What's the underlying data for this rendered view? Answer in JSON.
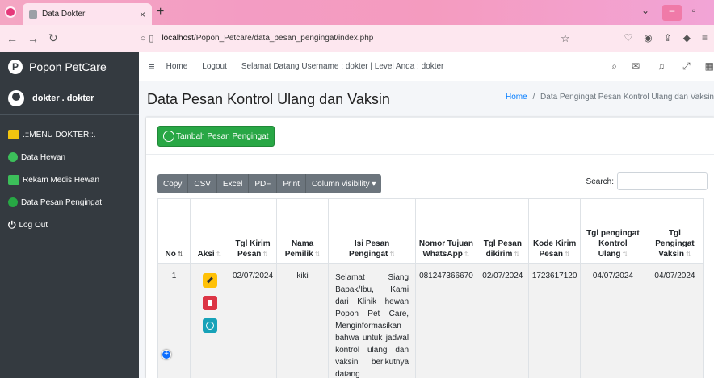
{
  "browser": {
    "tab_title": "Data Dokter",
    "tab_close": "×",
    "new_tab": "+",
    "url_host": "localhost",
    "url_path": "/Popon_Petcare/data_pesan_pengingat/index.php"
  },
  "sidebar": {
    "brand": "Popon PetCare",
    "brand_logo": "P",
    "user": "dokter . dokter",
    "items": [
      {
        "label": ".::MENU DOKTER::.",
        "icon": "id-card-icon"
      },
      {
        "label": "Data Hewan",
        "icon": "users-icon"
      },
      {
        "label": "Rekam Medis Hewan",
        "icon": "tags-icon"
      },
      {
        "label": "Data Pesan Pengingat",
        "icon": "whatsapp-icon"
      },
      {
        "label": "Log Out",
        "icon": "power-icon"
      }
    ]
  },
  "navbar": {
    "home": "Home",
    "logout": "Logout",
    "welcome": "Selamat Datang Username : dokter | Level Anda : dokter"
  },
  "content": {
    "title": "Data Pesan Kontrol Ulang dan Vaksin",
    "breadcrumb_home": "Home",
    "breadcrumb_sep": "/",
    "breadcrumb_current": "Data Pengingat Pesan Kontrol Ulang dan Vaksin",
    "add_button": "Tambah Pesan Pengingat"
  },
  "datatable": {
    "buttons": [
      "Copy",
      "CSV",
      "Excel",
      "PDF",
      "Print",
      "Column visibility ▾"
    ],
    "search_label": "Search:",
    "search_value": "",
    "columns": [
      "No",
      "Aksi",
      "Tgl Kirim Pesan",
      "Nama Pemilik",
      "Isi Pesan Pengingat",
      "Nomor Tujuan WhatsApp",
      "Tgl Pesan dikirim",
      "Kode Kirim Pesan",
      "Tgl pengingat Kontrol Ulang",
      "Tgl Pengingat Vaksin"
    ],
    "rows": [
      {
        "no": "1",
        "tgl_kirim": "02/07/2024",
        "nama_pemilik": "kiki",
        "isi_pesan": "Selamat Siang Bapak/Ibu, Kami dari Klinik hewan Popon Pet Care, Menginformasikan bahwa untuk jadwal kontrol ulang dan vaksin berikutnya datang",
        "nomor_wa": "081247366670",
        "tgl_dikirim": "02/07/2024",
        "kode_kirim": "1723617120",
        "tgl_kontrol": "04/07/2024",
        "tgl_vaksin": "04/07/2024"
      }
    ]
  }
}
